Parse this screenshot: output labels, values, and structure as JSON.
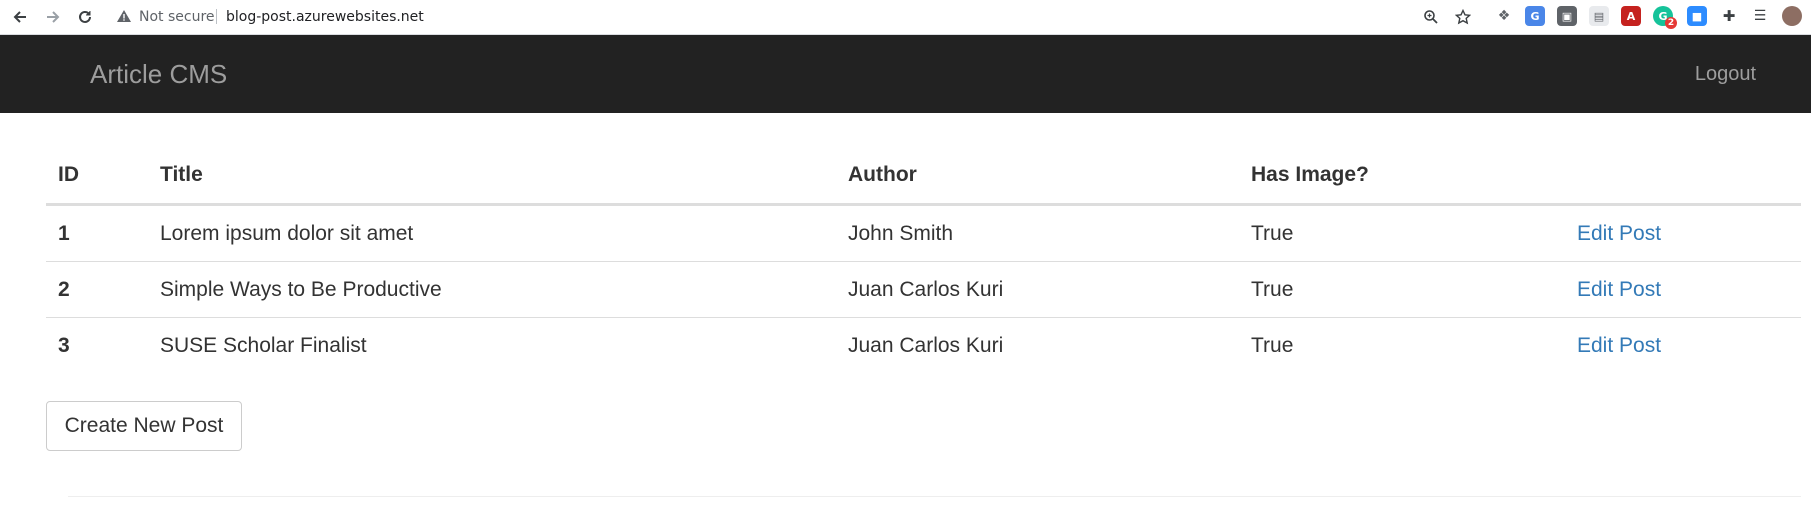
{
  "browser": {
    "security_label": "Not secure",
    "url": "blog-post.azurewebsites.net",
    "icons": [
      "back-icon",
      "forward-icon",
      "reload-icon",
      "warning-icon",
      "zoom-icon",
      "star-icon",
      "dropbox-icon",
      "translate-icon",
      "extension-icon",
      "reader-icon",
      "pdf-icon",
      "grammarly-icon",
      "zoom-meeting-icon",
      "puzzle-icon",
      "media-icon",
      "avatar"
    ],
    "grammarly_badge": "2"
  },
  "navbar": {
    "brand": "Article CMS",
    "logout_label": "Logout",
    "background": "#222222",
    "text_color": "#9d9d9d"
  },
  "table": {
    "columns": [
      "ID",
      "Title",
      "Author",
      "Has Image?",
      ""
    ],
    "rows": [
      {
        "id": "1",
        "title": "Lorem ipsum dolor sit amet",
        "author": "John Smith",
        "has_image": "True",
        "action": "Edit Post"
      },
      {
        "id": "2",
        "title": "Simple Ways to Be Productive",
        "author": "Juan Carlos Kuri",
        "has_image": "True",
        "action": "Edit Post"
      },
      {
        "id": "3",
        "title": "SUSE Scholar Finalist",
        "author": "Juan Carlos Kuri",
        "has_image": "True",
        "action": "Edit Post"
      }
    ],
    "link_color": "#337ab7"
  },
  "actions": {
    "create_label": "Create New Post"
  }
}
